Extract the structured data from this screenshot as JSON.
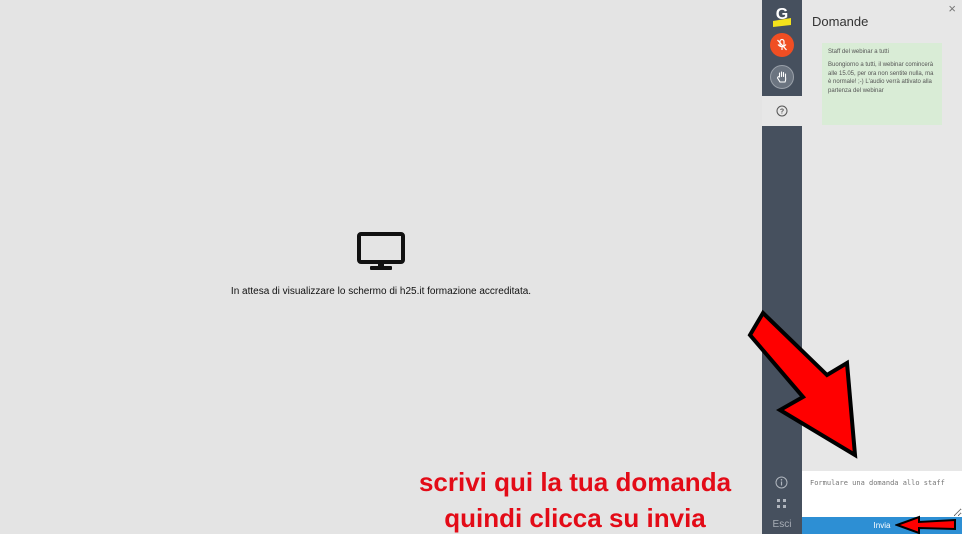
{
  "stage": {
    "waiting_text": "In attesa di visualizzare lo schermo di h25.it formazione accreditata."
  },
  "rail": {
    "logo_letter": "G",
    "exit_label": "Esci"
  },
  "panel": {
    "title": "Domande",
    "close_glyph": "×",
    "message": {
      "author": "Staff del webinar a tutti",
      "text": "Buongiorno a tutti, il webinar comincerà alle 15.05, per ora non sentite nulla, ma è normale! ;-) L'audio verrà attivato alla partenza del webinar"
    },
    "question_placeholder": "Formulare una domanda allo staff",
    "send_label": "Invia"
  },
  "annotation": {
    "line1": "scrivi qui la tua domanda",
    "line2": "quindi clicca su invia",
    "arrow_color": "#ff0000"
  },
  "colors": {
    "rail": "#46505e",
    "mic": "#f04e23",
    "send": "#2d8fd4",
    "message_bg": "#d9ecd6"
  }
}
